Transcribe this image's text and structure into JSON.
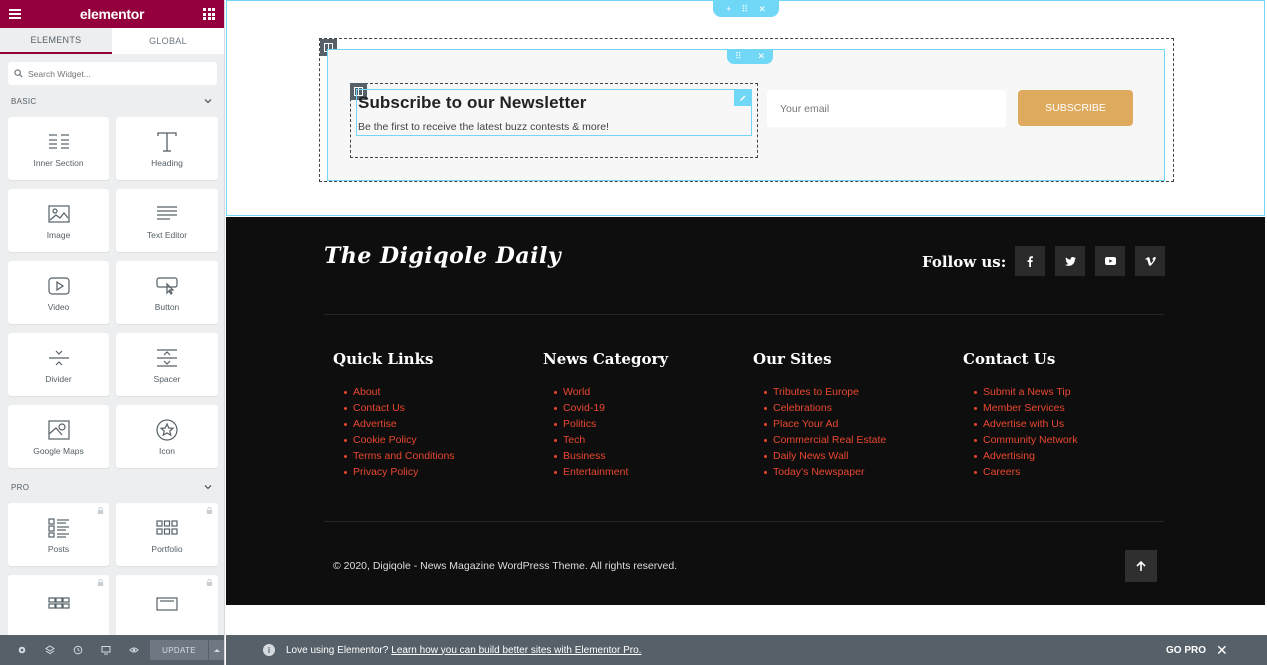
{
  "sidebar": {
    "brand": "elementor",
    "tabs": [
      "ELEMENTS",
      "GLOBAL"
    ],
    "search_placeholder": "Search Widget...",
    "sections": [
      {
        "title": "BASIC",
        "widgets": [
          "Inner Section",
          "Heading",
          "Image",
          "Text Editor",
          "Video",
          "Button",
          "Divider",
          "Spacer",
          "Google Maps",
          "Icon"
        ]
      },
      {
        "title": "PRO",
        "widgets": [
          "Posts",
          "Portfolio",
          "",
          ""
        ]
      }
    ],
    "update_label": "UPDATE"
  },
  "newsletter": {
    "title": "Subscribe to our Newsletter",
    "subtitle": "Be the first to receive the latest buzz contests & more!",
    "email_placeholder": "Your email",
    "button_label": "SUBSCRIBE"
  },
  "footer": {
    "logo": "The Digiqole Daily",
    "follow_label": "Follow us:",
    "social_icons": [
      "facebook-icon",
      "twitter-icon",
      "youtube-icon",
      "vimeo-icon"
    ],
    "columns": [
      {
        "title": "Quick Links",
        "links": [
          "About",
          "Contact Us",
          "Advertise",
          "Cookie Policy",
          "Terms and Conditions",
          "Privacy Policy"
        ]
      },
      {
        "title": "News Category",
        "links": [
          "World",
          "Covid-19",
          "Politics",
          "Tech",
          "Business",
          "Entertainment"
        ]
      },
      {
        "title": "Our Sites",
        "links": [
          "Tributes to Europe",
          "Celebrations",
          "Place Your Ad",
          "Commercial Real Estate",
          "Daily News Wall",
          "Today’s Newspaper"
        ]
      },
      {
        "title": "Contact Us",
        "links": [
          "Submit a News Tip",
          "Member Services",
          "Advertise with Us",
          "Community Network",
          "Advertising",
          "Careers"
        ]
      }
    ],
    "copyright": "© 2020, Digiqole - News Magazine WordPress Theme. All rights reserved."
  },
  "promo": {
    "text": "Love using Elementor?",
    "link": "Learn how you can build better sites with Elementor Pro.",
    "go_pro": "GO PRO"
  },
  "colors": {
    "brand": "#93003c",
    "accent": "#71d7f7",
    "subscribe": "#deaa5e",
    "link": "#e8472f"
  }
}
